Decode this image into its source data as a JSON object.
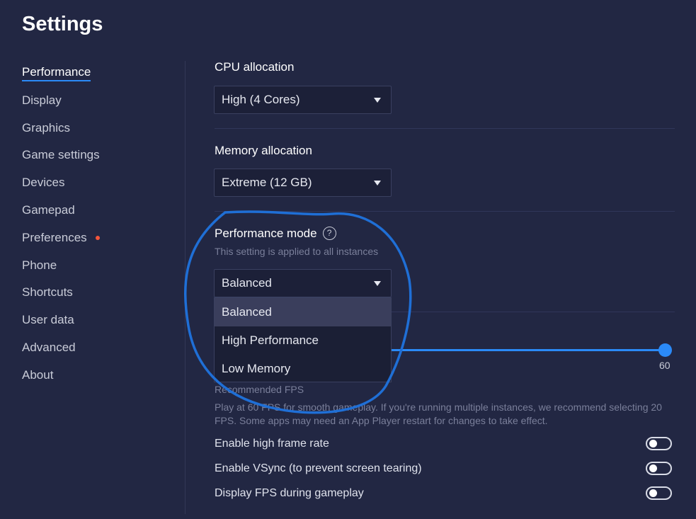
{
  "page": {
    "title": "Settings"
  },
  "sidebar": {
    "items": [
      {
        "label": "Performance"
      },
      {
        "label": "Display"
      },
      {
        "label": "Graphics"
      },
      {
        "label": "Game settings"
      },
      {
        "label": "Devices"
      },
      {
        "label": "Gamepad"
      },
      {
        "label": "Preferences"
      },
      {
        "label": "Phone"
      },
      {
        "label": "Shortcuts"
      },
      {
        "label": "User data"
      },
      {
        "label": "Advanced"
      },
      {
        "label": "About"
      }
    ],
    "active": "Performance",
    "notification_on": "Preferences"
  },
  "cpu": {
    "label": "CPU allocation",
    "value": "High (4 Cores)"
  },
  "memory": {
    "label": "Memory allocation",
    "value": "Extreme (12 GB)"
  },
  "performance_mode": {
    "label": "Performance mode",
    "help_glyph": "?",
    "subtext": "This setting is applied to all instances",
    "value": "Balanced",
    "options": [
      "Balanced",
      "High Performance",
      "Low Memory"
    ]
  },
  "fps": {
    "value": "60",
    "caption": "Recommended FPS",
    "description": "Play at 60 FPS for smooth gameplay. If you're running multiple instances, we recommend selecting 20 FPS. Some apps may need an App Player restart for changes to take effect."
  },
  "toggles": [
    {
      "label": "Enable high frame rate",
      "on": false
    },
    {
      "label": "Enable VSync (to prevent screen tearing)",
      "on": false
    },
    {
      "label": "Display FPS during gameplay",
      "on": false
    }
  ],
  "colors": {
    "background": "#222743",
    "accent": "#2b8af7",
    "notification_dot": "#f4553b",
    "annotation": "#1f6fd6"
  },
  "icons": {
    "dropdown": "caret-down-icon",
    "help": "help-circle-icon"
  }
}
